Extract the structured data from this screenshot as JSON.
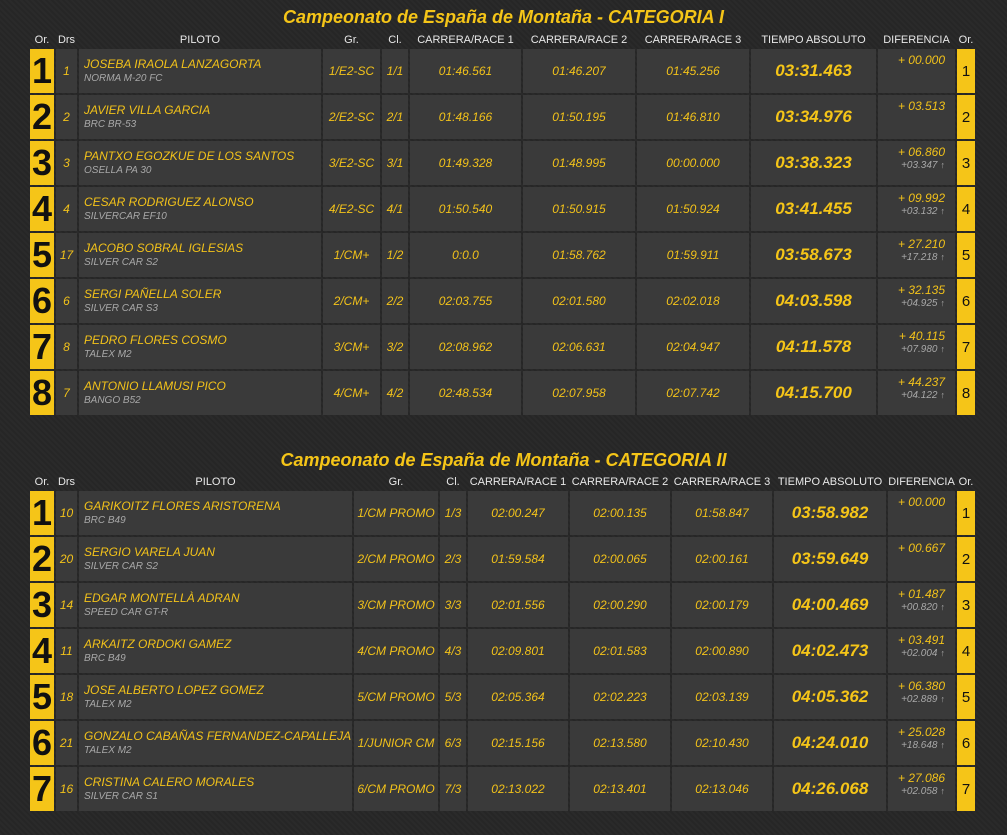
{
  "categories": [
    {
      "title": "Campeonato de España de Montaña - CATEGORIA I",
      "headers": {
        "or": "Or.",
        "drs": "Drs",
        "piloto": "PILOTO",
        "gr": "Gr.",
        "cl": "Cl.",
        "r1": "CARRERA/RACE 1",
        "r2": "CARRERA/RACE 2",
        "r3": "CARRERA/RACE 3",
        "abs": "TIEMPO ABSOLUTO",
        "dif": "DIFERENCIA",
        "or2": "Or."
      },
      "rows": [
        {
          "pos": "1",
          "drs": "1",
          "name": "JOSEBA IRAOLA LANZAGORTA",
          "car": "NORMA M-20 FC",
          "gr": "1/E2-SC",
          "cl": "1/1",
          "r1": "01:46.561",
          "r2": "01:46.207",
          "r3": "01:45.256",
          "abs": "03:31.463",
          "dif": "+ 00.000",
          "dif2": "",
          "arrow": ""
        },
        {
          "pos": "2",
          "drs": "2",
          "name": "JAVIER VILLA GARCIA",
          "car": "BRC BR-53",
          "gr": "2/E2-SC",
          "cl": "2/1",
          "r1": "01:48.166",
          "r2": "01:50.195",
          "r3": "01:46.810",
          "abs": "03:34.976",
          "dif": "+ 03.513",
          "dif2": "",
          "arrow": ""
        },
        {
          "pos": "3",
          "drs": "3",
          "name": "PANTXO EGOZKUE DE LOS SANTOS",
          "car": "OSELLA PA 30",
          "gr": "3/E2-SC",
          "cl": "3/1",
          "r1": "01:49.328",
          "r2": "01:48.995",
          "r3": "00:00.000",
          "abs": "03:38.323",
          "dif": "+ 06.860",
          "dif2": "+03.347",
          "arrow": "↑"
        },
        {
          "pos": "4",
          "drs": "4",
          "name": "CESAR RODRIGUEZ ALONSO",
          "car": "SILVERCAR EF10",
          "gr": "4/E2-SC",
          "cl": "4/1",
          "r1": "01:50.540",
          "r2": "01:50.915",
          "r3": "01:50.924",
          "abs": "03:41.455",
          "dif": "+ 09.992",
          "dif2": "+03.132",
          "arrow": "↑"
        },
        {
          "pos": "5",
          "drs": "17",
          "name": "JACOBO SOBRAL IGLESIAS",
          "car": "SILVER CAR S2",
          "gr": "1/CM+",
          "cl": "1/2",
          "r1": "0:0.0",
          "r2": "01:58.762",
          "r3": "01:59.911",
          "abs": "03:58.673",
          "dif": "+ 27.210",
          "dif2": "+17.218",
          "arrow": "↑"
        },
        {
          "pos": "6",
          "drs": "6",
          "name": "SERGI PAÑELLA SOLER",
          "car": "SILVER CAR S3",
          "gr": "2/CM+",
          "cl": "2/2",
          "r1": "02:03.755",
          "r2": "02:01.580",
          "r3": "02:02.018",
          "abs": "04:03.598",
          "dif": "+ 32.135",
          "dif2": "+04.925",
          "arrow": "↑"
        },
        {
          "pos": "7",
          "drs": "8",
          "name": "PEDRO FLORES COSMO",
          "car": "TALEX M2",
          "gr": "3/CM+",
          "cl": "3/2",
          "r1": "02:08.962",
          "r2": "02:06.631",
          "r3": "02:04.947",
          "abs": "04:11.578",
          "dif": "+ 40.115",
          "dif2": "+07.980",
          "arrow": "↑"
        },
        {
          "pos": "8",
          "drs": "7",
          "name": "ANTONIO LLAMUSI PICO",
          "car": "BANGO B52",
          "gr": "4/CM+",
          "cl": "4/2",
          "r1": "02:48.534",
          "r2": "02:07.958",
          "r3": "02:07.742",
          "abs": "04:15.700",
          "dif": "+ 44.237",
          "dif2": "+04.122",
          "arrow": "↑"
        }
      ]
    },
    {
      "title": "Campeonato de España de Montaña - CATEGORIA II",
      "headers": {
        "or": "Or.",
        "drs": "Drs",
        "piloto": "PILOTO",
        "gr": "Gr.",
        "cl": "Cl.",
        "r1": "CARRERA/RACE 1",
        "r2": "CARRERA/RACE 2",
        "r3": "CARRERA/RACE 3",
        "abs": "TIEMPO ABSOLUTO",
        "dif": "DIFERENCIA",
        "or2": "Or."
      },
      "rows": [
        {
          "pos": "1",
          "drs": "10",
          "name": "GARIKOITZ FLORES ARISTORENA",
          "car": "BRC B49",
          "gr": "1/CM PROMO",
          "cl": "1/3",
          "r1": "02:00.247",
          "r2": "02:00.135",
          "r3": "01:58.847",
          "abs": "03:58.982",
          "dif": "+ 00.000",
          "dif2": "",
          "arrow": ""
        },
        {
          "pos": "2",
          "drs": "20",
          "name": "SERGIO VARELA JUAN",
          "car": "SILVER CAR S2",
          "gr": "2/CM PROMO",
          "cl": "2/3",
          "r1": "01:59.584",
          "r2": "02:00.065",
          "r3": "02:00.161",
          "abs": "03:59.649",
          "dif": "+ 00.667",
          "dif2": "",
          "arrow": ""
        },
        {
          "pos": "3",
          "drs": "14",
          "name": "EDGAR MONTELLÀ ADRAN",
          "car": "SPEED CAR GT-R",
          "gr": "3/CM PROMO",
          "cl": "3/3",
          "r1": "02:01.556",
          "r2": "02:00.290",
          "r3": "02:00.179",
          "abs": "04:00.469",
          "dif": "+ 01.487",
          "dif2": "+00.820",
          "arrow": "↑"
        },
        {
          "pos": "4",
          "drs": "11",
          "name": "ARKAITZ ORDOKI GAMEZ",
          "car": "BRC B49",
          "gr": "4/CM PROMO",
          "cl": "4/3",
          "r1": "02:09.801",
          "r2": "02:01.583",
          "r3": "02:00.890",
          "abs": "04:02.473",
          "dif": "+ 03.491",
          "dif2": "+02.004",
          "arrow": "↑"
        },
        {
          "pos": "5",
          "drs": "18",
          "name": "JOSE ALBERTO LOPEZ GOMEZ",
          "car": "TALEX M2",
          "gr": "5/CM PROMO",
          "cl": "5/3",
          "r1": "02:05.364",
          "r2": "02:02.223",
          "r3": "02:03.139",
          "abs": "04:05.362",
          "dif": "+ 06.380",
          "dif2": "+02.889",
          "arrow": "↑"
        },
        {
          "pos": "6",
          "drs": "21",
          "name": "GONZALO CABAÑAS FERNANDEZ-CAPALLEJA",
          "car": "TALEX M2",
          "gr": "1/JUNIOR CM",
          "cl": "6/3",
          "r1": "02:15.156",
          "r2": "02:13.580",
          "r3": "02:10.430",
          "abs": "04:24.010",
          "dif": "+ 25.028",
          "dif2": "+18.648",
          "arrow": "↑"
        },
        {
          "pos": "7",
          "drs": "16",
          "name": "CRISTINA CALERO MORALES",
          "car": "SILVER CAR S1",
          "gr": "6/CM PROMO",
          "cl": "7/3",
          "r1": "02:13.022",
          "r2": "02:13.401",
          "r3": "02:13.046",
          "abs": "04:26.068",
          "dif": "+ 27.086",
          "dif2": "+02.058",
          "arrow": "↑"
        }
      ]
    }
  ]
}
